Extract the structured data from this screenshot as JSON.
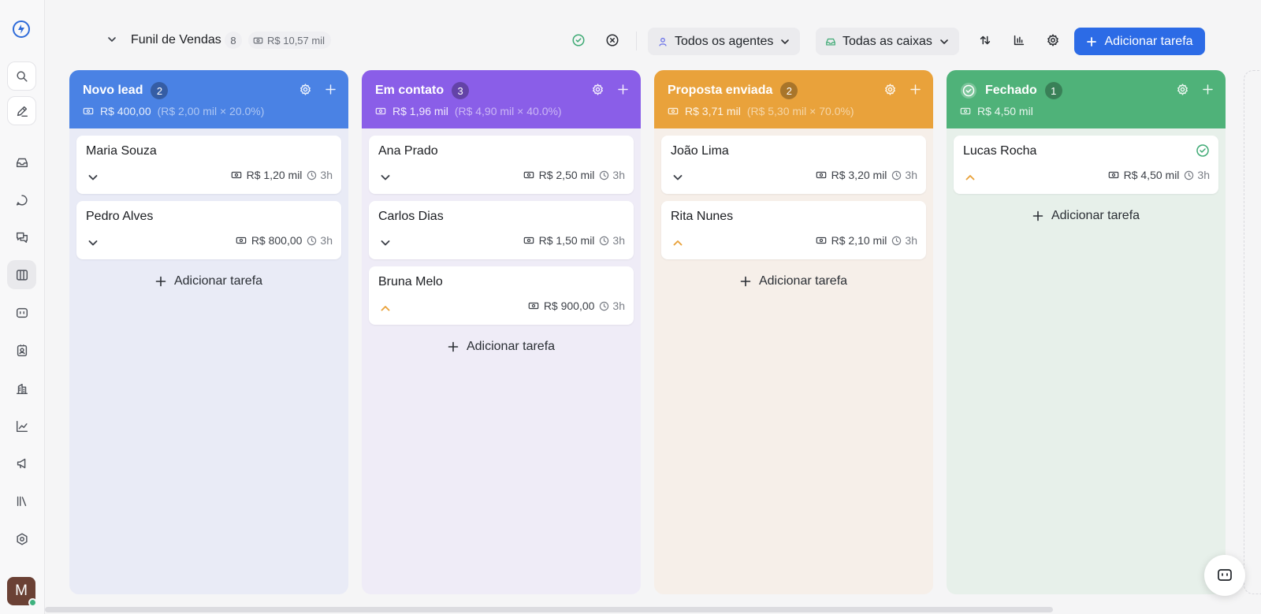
{
  "sidebar": {
    "logo_icon": "chat-logo-icon",
    "items": [
      {
        "icon": "search-icon"
      },
      {
        "icon": "compose-icon"
      },
      {
        "icon": "inbox-icon"
      },
      {
        "icon": "conversation-icon"
      },
      {
        "icon": "chats-icon"
      },
      {
        "icon": "kanban-icon"
      },
      {
        "icon": "captain-icon"
      },
      {
        "icon": "contacts-icon"
      },
      {
        "icon": "companies-icon"
      },
      {
        "icon": "reports-icon"
      },
      {
        "icon": "campaigns-icon"
      },
      {
        "icon": "library-icon"
      },
      {
        "icon": "settings-icon"
      }
    ],
    "avatar_initial": "M"
  },
  "header": {
    "title": "Funil de Vendas",
    "count": "8",
    "total": "R$ 10,57 mil",
    "agents_filter": "Todos os agentes",
    "inbox_filter": "Todas as caixas",
    "add_task": "Adicionar tarefa"
  },
  "board": {
    "add_task_label": "Adicionar tarefa",
    "columns": [
      {
        "title": "Novo lead",
        "count": "2",
        "value": "R$ 400,00",
        "calc": "(R$ 2,00 mil × 20.0%)",
        "color": "#4a82e4",
        "body_color": "#e9ebf6",
        "cards": [
          {
            "name": "Maria Souza",
            "value": "R$ 1,20 mil",
            "time": "3h",
            "priority": "down"
          },
          {
            "name": "Pedro Alves",
            "value": "R$ 800,00",
            "time": "3h",
            "priority": "down"
          }
        ]
      },
      {
        "title": "Em contato",
        "count": "3",
        "value": "R$ 1,96 mil",
        "calc": "(R$ 4,90 mil × 40.0%)",
        "color": "#8a5ee8",
        "body_color": "#efecf7",
        "cards": [
          {
            "name": "Ana Prado",
            "value": "R$ 2,50 mil",
            "time": "3h",
            "priority": "down"
          },
          {
            "name": "Carlos Dias",
            "value": "R$ 1,50 mil",
            "time": "3h",
            "priority": "down"
          },
          {
            "name": "Bruna Melo",
            "value": "R$ 900,00",
            "time": "3h",
            "priority": "up"
          }
        ]
      },
      {
        "title": "Proposta enviada",
        "count": "2",
        "value": "R$ 3,71 mil",
        "calc": "(R$ 5,30 mil × 70.0%)",
        "color": "#e9a23b",
        "body_color": "#f6efe9",
        "cards": [
          {
            "name": "João Lima",
            "value": "R$ 3,20 mil",
            "time": "3h",
            "priority": "down"
          },
          {
            "name": "Rita Nunes",
            "value": "R$ 2,10 mil",
            "time": "3h",
            "priority": "up"
          }
        ]
      },
      {
        "title": "Fechado",
        "count": "1",
        "value": "R$ 4,50 mil",
        "calc": "",
        "color": "#4fb279",
        "body_color": "#e7f0ea",
        "cards": [
          {
            "name": "Lucas Rocha",
            "value": "R$ 4,50 mil",
            "time": "3h",
            "priority": "up",
            "done": true
          }
        ]
      }
    ]
  }
}
